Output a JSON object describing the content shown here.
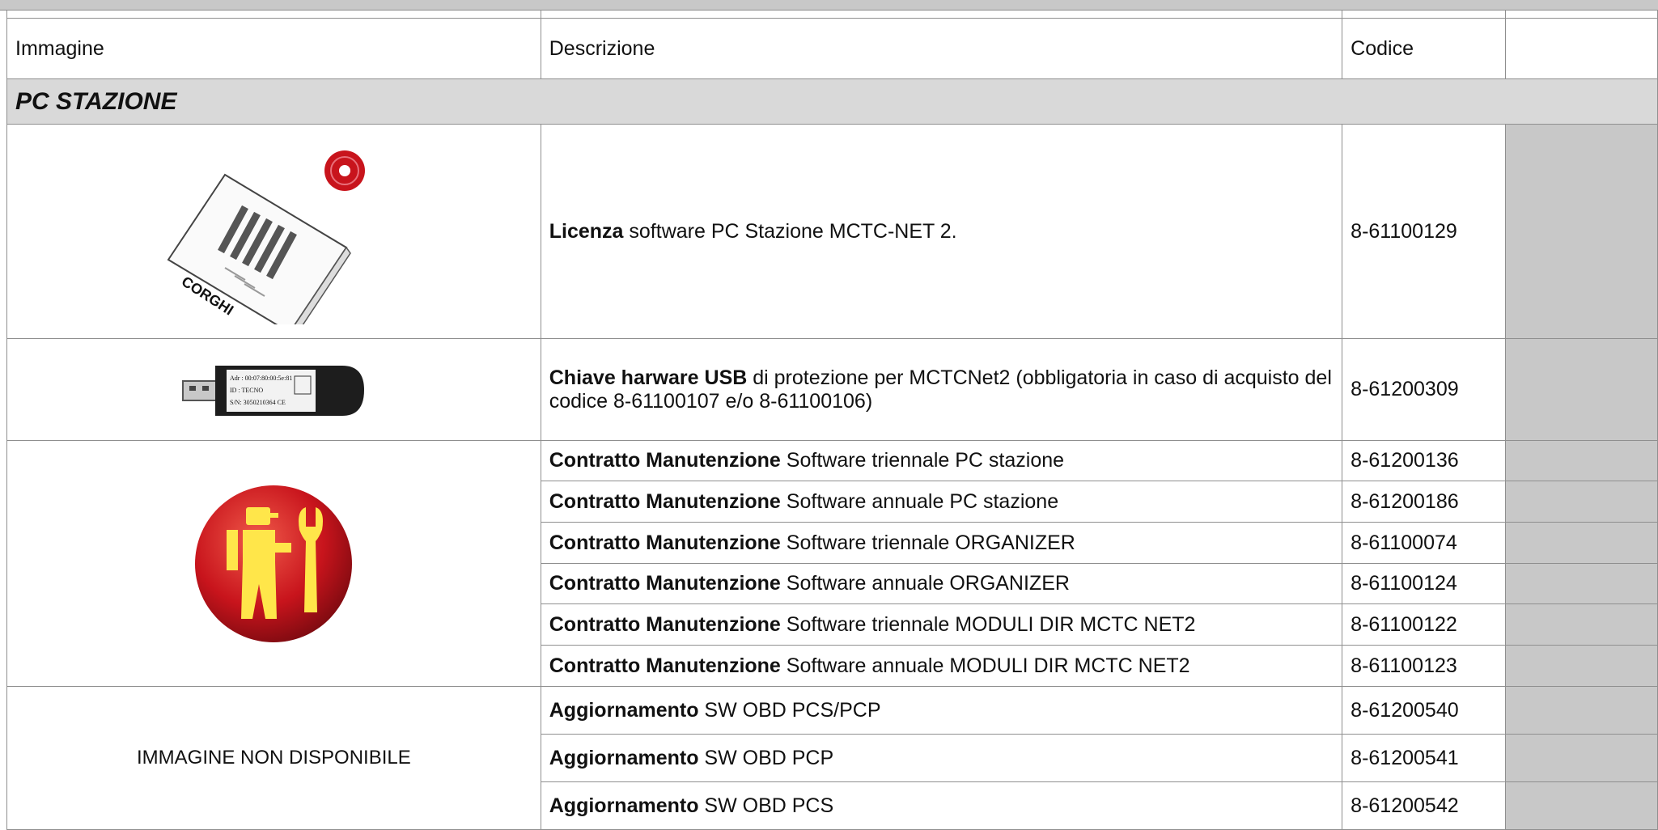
{
  "header": {
    "image": "Immagine",
    "description": "Descrizione",
    "code": "Codice",
    "price": ""
  },
  "section": {
    "title": "PC STAZIONE"
  },
  "rows": [
    {
      "bold": "Licenza",
      "text": " software PC Stazione MCTC-NET 2.",
      "code": "8-61100129"
    },
    {
      "bold": "Chiave harware USB",
      "text": " di protezione per MCTCNet2 (obbligatoria in caso di acquisto del codice 8-61100107 e/o 8-61100106)",
      "code": "8-61200309"
    },
    {
      "bold": "Contratto Manutenzione",
      "text": " Software triennale PC stazione",
      "code": "8-61200136"
    },
    {
      "bold": "Contratto Manutenzione",
      "text": " Software annuale PC stazione",
      "code": "8-61200186"
    },
    {
      "bold": "Contratto Manutenzione",
      "text": " Software triennale ORGANIZER",
      "code": "8-61100074"
    },
    {
      "bold": "Contratto Manutenzione",
      "text": " Software annuale ORGANIZER",
      "code": "8-61100124"
    },
    {
      "bold": "Contratto Manutenzione",
      "text": " Software triennale MODULI DIR MCTC NET2",
      "code": "8-61100122"
    },
    {
      "bold": "Contratto Manutenzione",
      "text": " Software annuale MODULI DIR MCTC NET2",
      "code": "8-61100123"
    },
    {
      "bold": "Aggiornamento",
      "text": " SW OBD PCS/PCP",
      "code": "8-61200540"
    },
    {
      "bold": "Aggiornamento",
      "text": " SW OBD PCP",
      "code": "8-61200541"
    },
    {
      "bold": "Aggiornamento",
      "text": " SW OBD PCS",
      "code": "8-61200542"
    }
  ],
  "images": {
    "licence": {
      "icon": "software-licence-box-icon",
      "brand": "CORGHI"
    },
    "usb": {
      "icon": "usb-dongle-icon",
      "label_lines": [
        "Adr : 00:07:80:00:5e:81",
        "ID : TECNO",
        "S/N: 3050210364 CE"
      ]
    },
    "maintenance": {
      "icon": "maintenance-technician-icon"
    },
    "unavailable_text": "IMMAGINE NON DISPONIBILE"
  },
  "colors": {
    "price_column": "#c8c8c8",
    "section_bg": "#d9d9d9",
    "border": "#8f8f8f",
    "icon_red": "#c8141c",
    "icon_yellow": "#ffe64a"
  }
}
